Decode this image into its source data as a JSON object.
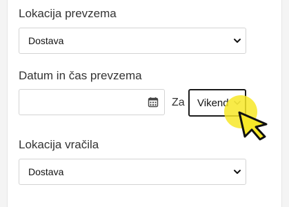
{
  "pickup_location": {
    "label": "Lokacija prevzema",
    "selected": "Dostava"
  },
  "pickup_datetime": {
    "label": "Datum in čas prevzema",
    "date_value": "",
    "za_label": "Za",
    "time_selected": "Vikend"
  },
  "return_location": {
    "label": "Lokacija vračila",
    "selected": "Dostava"
  },
  "icons": {
    "calendar": "calendar-icon",
    "chevron": "chevron-down-icon",
    "cursor": "mouse-pointer-icon"
  },
  "colors": {
    "cursor_highlight": "#f7e828",
    "active_border": "#1a1a1a",
    "field_border": "#d3d3d3"
  }
}
